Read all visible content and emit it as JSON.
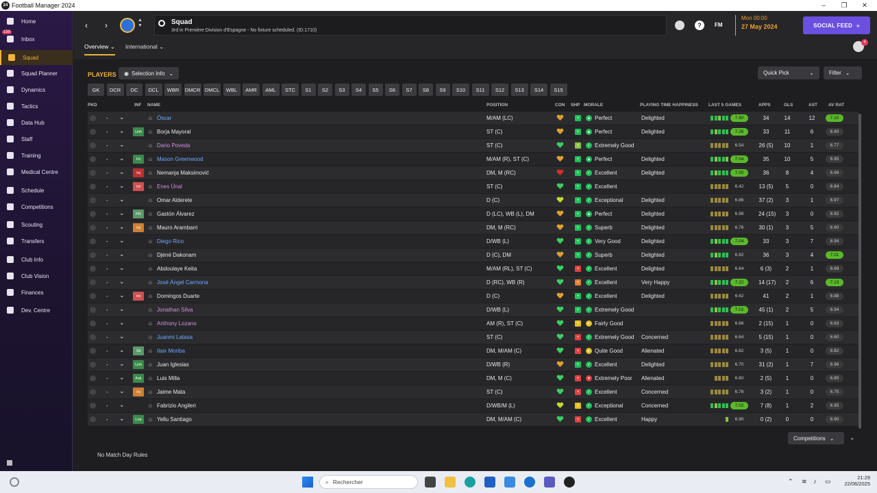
{
  "window": {
    "title": "Football Manager 2024",
    "icon_text": "24"
  },
  "sidebar": {
    "items": [
      {
        "label": "Home",
        "icon": "home-icon"
      },
      {
        "label": "Inbox",
        "icon": "inbox-icon",
        "badge": "150"
      },
      {
        "label": "Squad",
        "icon": "squad-icon",
        "active": true
      },
      {
        "label": "Squad Planner",
        "icon": "planner-icon"
      },
      {
        "label": "Dynamics",
        "icon": "dynamics-icon"
      },
      {
        "label": "Tactics",
        "icon": "tactics-icon"
      },
      {
        "label": "Data Hub",
        "icon": "datahub-icon"
      },
      {
        "label": "Staff",
        "icon": "staff-icon"
      },
      {
        "label": "Training",
        "icon": "training-icon"
      },
      {
        "label": "Medical Centre",
        "icon": "medical-icon"
      },
      {
        "label": "Schedule",
        "icon": "schedule-icon"
      },
      {
        "label": "Competitions",
        "icon": "trophy-icon"
      },
      {
        "label": "Scouting",
        "icon": "scouting-icon"
      },
      {
        "label": "Transfers",
        "icon": "transfers-icon"
      },
      {
        "label": "Club Info",
        "icon": "clubinfo-icon"
      },
      {
        "label": "Club Vision",
        "icon": "vision-icon"
      },
      {
        "label": "Finances",
        "icon": "finances-icon"
      },
      {
        "label": "Dev. Centre",
        "icon": "devcentre-icon"
      }
    ]
  },
  "header": {
    "title": "Squad",
    "subtitle": "3rd in Première Division d'Espagne - No fixture scheduled. (ID:1710)",
    "fm_label": "FM",
    "date_line1": "Mon 00:00",
    "date_line2": "27 May 2024",
    "social_feed": "SOCIAL FEED",
    "notif_count": "4",
    "tabs": [
      "Overview",
      "International"
    ]
  },
  "toolbar": {
    "players_label": "PLAYERS",
    "selection_info": "Selection Info",
    "quick_pick": "Quick Pick",
    "filter": "Filter",
    "positions": [
      "GK",
      "DCR",
      "DC",
      "DCL",
      "WBR",
      "DMCR",
      "DMCL",
      "WBL",
      "AMR",
      "AML",
      "STC",
      "S1",
      "S2",
      "S3",
      "S4",
      "S5",
      "S6",
      "S7",
      "S8",
      "S9",
      "S10",
      "S11",
      "S12",
      "S13",
      "S14",
      "S15"
    ]
  },
  "table": {
    "headers": {
      "pkd": "PKD",
      "inf": "INF",
      "name": "NAME",
      "position": "POSITION",
      "con": "CON",
      "shp": "SHP",
      "morale": "MORALE",
      "pth": "PLAYING TIME HAPPINESS",
      "last5": "LAST 5 GAMES",
      "apps": "APPS",
      "gls": "GLS",
      "ast": "AST",
      "avrat": "AV RAT"
    },
    "rows": [
      {
        "name": "Óscar",
        "nc": "blue",
        "inf": "",
        "pos": "M/AM (LC)",
        "morale": "Perfect",
        "mc": "#1fbf5a",
        "ms": "▲",
        "shp": "#1fbf5a",
        "pth": "Delighted",
        "rat": "7.90",
        "rc": "#5ab82a",
        "form": [
          1,
          1,
          0.6,
          1,
          0.8
        ],
        "apps": "34",
        "gls": "14",
        "ast": "12",
        "av": "7.10",
        "ac": "#5ab82a",
        "con": "#e0a030"
      },
      {
        "name": "Borja Mayoral",
        "nc": "",
        "inf": "Unh",
        "ic": "#3a8a4a",
        "pos": "ST (C)",
        "morale": "Perfect",
        "mc": "#1fbf5a",
        "ms": "▲",
        "shp": "#1fbf5a",
        "pth": "Delighted",
        "rat": "7.26",
        "rc": "#5ab82a",
        "form": [
          1,
          0.6,
          1,
          0.8,
          1
        ],
        "apps": "33",
        "gls": "11",
        "ast": "6",
        "av": "6.80",
        "ac": "",
        "con": "#e0a030"
      },
      {
        "name": "Dario Poveda",
        "nc": "pink",
        "inf": "",
        "pos": "ST (C)",
        "morale": "Extremely Good",
        "mc": "#1fbf5a",
        "ms": "✓",
        "shp": "#8bc34a",
        "pth": "",
        "rat": "6.54",
        "rc": "",
        "form": [
          0.5,
          0.5,
          0.5,
          0.5,
          0.5
        ],
        "apps": "26 (5)",
        "gls": "10",
        "ast": "1",
        "av": "6.77",
        "ac": "",
        "con": "#3ad060"
      },
      {
        "name": "Mason Greenwood",
        "nc": "blue",
        "inf": "Fit",
        "ic": "#3a8a4a",
        "pos": "M/AM (R), ST (C)",
        "morale": "Perfect",
        "mc": "#1fbf5a",
        "ms": "▲",
        "shp": "#1fbf5a",
        "pth": "Delighted",
        "rat": "7.04",
        "rc": "#5ab82a",
        "form": [
          1,
          0.6,
          0.8,
          1,
          0.7
        ],
        "apps": "35",
        "gls": "10",
        "ast": "5",
        "av": "6.95",
        "ac": "",
        "con": "#e0a030"
      },
      {
        "name": "Nemanja Maksimović",
        "nc": "",
        "inf": "Inj",
        "ic": "#c03030",
        "pos": "DM, M (RC)",
        "morale": "Excellent",
        "mc": "#1fbf5a",
        "ms": "✓",
        "shp": "#1fbf5a",
        "pth": "Delighted",
        "rat": "7.00",
        "rc": "#5ab82a",
        "form": [
          1,
          0.6,
          1,
          0.8,
          1
        ],
        "apps": "36",
        "gls": "8",
        "ast": "4",
        "av": "6.99",
        "ac": "",
        "con": "#d03030"
      },
      {
        "name": "Enes Ünal",
        "nc": "pink",
        "inf": "Int",
        "ic": "#d05050",
        "pos": "ST (C)",
        "morale": "Excellent",
        "mc": "#1fbf5a",
        "ms": "✓",
        "shp": "#1fbf5a",
        "pth": "",
        "rat": "6.42",
        "rc": "",
        "form": [
          0.5,
          0.5,
          0.5,
          0.5,
          0.5
        ],
        "apps": "13 (5)",
        "gls": "5",
        "ast": "0",
        "av": "6.84",
        "ac": "",
        "con": "#3ad060"
      },
      {
        "name": "Omar Alderete",
        "nc": "",
        "inf": "",
        "pos": "D (C)",
        "morale": "Exceptional",
        "mc": "#1fbf5a",
        "ms": "✓",
        "shp": "#1fbf5a",
        "pth": "Delighted",
        "rat": "6.86",
        "rc": "",
        "form": [
          0.5,
          0.5,
          0.5,
          0.5,
          0.5
        ],
        "apps": "37 (2)",
        "gls": "3",
        "ast": "1",
        "av": "6.97",
        "ac": "",
        "con": "#c8d830"
      },
      {
        "name": "Gastón Álvarez",
        "nc": "",
        "inf": "PR",
        "ic": "#5a9a6a",
        "pos": "D (LC), WB (L), DM",
        "morale": "Perfect",
        "mc": "#1fbf5a",
        "ms": "▲",
        "shp": "#1fbf5a",
        "pth": "Delighted",
        "rat": "6.98",
        "rc": "",
        "form": [
          0.5,
          0.5,
          0.5,
          0.5,
          0.5
        ],
        "apps": "24 (15)",
        "gls": "3",
        "ast": "0",
        "av": "6.92",
        "ac": "",
        "con": "#e0a030"
      },
      {
        "name": "Mauro Arambarri",
        "nc": "",
        "inf": "Inj",
        "ic": "#d08030",
        "pos": "DM, M (RC)",
        "morale": "Superb",
        "mc": "#1fbf5a",
        "ms": "✓",
        "shp": "#1fbf5a",
        "pth": "Delighted",
        "rat": "6.76",
        "rc": "",
        "form": [
          0.5,
          0.5,
          0.5,
          0.5,
          0.5
        ],
        "apps": "30 (1)",
        "gls": "3",
        "ast": "5",
        "av": "6.80",
        "ac": "",
        "con": "#e0a030"
      },
      {
        "name": "Diego Rico",
        "nc": "blue",
        "inf": "",
        "pos": "D/WB (L)",
        "morale": "Very Good",
        "mc": "#1fbf5a",
        "ms": "✓",
        "shp": "#1fbf5a",
        "pth": "Delighted",
        "rat": "7.04",
        "rc": "#5ab82a",
        "form": [
          1,
          0.6,
          1,
          0.8,
          1
        ],
        "apps": "33",
        "gls": "3",
        "ast": "7",
        "av": "6.94",
        "ac": "",
        "con": "#3ad060"
      },
      {
        "name": "Djéné Dakonam",
        "nc": "",
        "inf": "",
        "pos": "D (C), DM",
        "morale": "Superb",
        "mc": "#1fbf5a",
        "ms": "✓",
        "shp": "#1fbf5a",
        "pth": "Delighted",
        "rat": "6.92",
        "rc": "",
        "form": [
          1,
          0.6,
          1,
          0.8,
          1
        ],
        "apps": "36",
        "gls": "3",
        "ast": "4",
        "av": "7.01",
        "ac": "#5ab82a",
        "con": "#e0a030"
      },
      {
        "name": "Abdoulaye Keita",
        "nc": "",
        "inf": "",
        "pos": "M/AM (RL), ST (C)",
        "morale": "Excellent",
        "mc": "#1fbf5a",
        "ms": "✓",
        "shp": "#e04040",
        "pth": "Delighted",
        "rat": "6.64",
        "rc": "",
        "form": [
          0.5,
          0.5,
          0.5,
          0.5,
          0.5
        ],
        "apps": "6 (3)",
        "gls": "2",
        "ast": "1",
        "av": "6.69",
        "ac": "",
        "con": "#3ad060"
      },
      {
        "name": "José Ángel Carmona",
        "nc": "blue",
        "inf": "",
        "pos": "D (RC), WB (R)",
        "morale": "Excellent",
        "mc": "#1fbf5a",
        "ms": "✓",
        "shp": "#e08030",
        "pth": "Very Happy",
        "rat": "7.22",
        "rc": "#5ab82a",
        "form": [
          1,
          0.6,
          1,
          0.8,
          1
        ],
        "apps": "14 (17)",
        "gls": "2",
        "ast": "6",
        "av": "7.13",
        "ac": "#5ab82a",
        "con": "#3ad060"
      },
      {
        "name": "Domingos Duarte",
        "nc": "",
        "inf": "Int",
        "ic": "#d05050",
        "pos": "D (C)",
        "morale": "Excellent",
        "mc": "#1fbf5a",
        "ms": "✓",
        "shp": "#1fbf5a",
        "pth": "Delighted",
        "rat": "6.62",
        "rc": "",
        "form": [
          0.5,
          0.5,
          0.5,
          0.5,
          0.5
        ],
        "apps": "41",
        "gls": "2",
        "ast": "1",
        "av": "6.88",
        "ac": "",
        "con": "#e0a030"
      },
      {
        "name": "Jonathan Silva",
        "nc": "pink",
        "inf": "",
        "pos": "D/WB (L)",
        "morale": "Extremely Good",
        "mc": "#1fbf5a",
        "ms": "✓",
        "shp": "#1fbf5a",
        "pth": "",
        "rat": "7.02",
        "rc": "#5ab82a",
        "form": [
          1,
          0.6,
          1,
          0.8,
          1
        ],
        "apps": "45 (1)",
        "gls": "2",
        "ast": "5",
        "av": "6.94",
        "ac": "",
        "con": "#3ad060"
      },
      {
        "name": "Anthony Lozano",
        "nc": "pink",
        "inf": "",
        "pos": "AM (R), ST (C)",
        "morale": "Fairly Good",
        "mc": "#e0c020",
        "ms": "▸",
        "shp": "#e0c020",
        "pth": "",
        "rat": "6.66",
        "rc": "",
        "form": [
          0.5,
          0.5,
          0.5,
          0.5,
          0.5
        ],
        "apps": "2 (15)",
        "gls": "1",
        "ast": "0",
        "av": "6.63",
        "ac": "",
        "con": "#3ad060"
      },
      {
        "name": "Juanmi Latasa",
        "nc": "blue",
        "inf": "",
        "pos": "ST (C)",
        "morale": "Extremely Good",
        "mc": "#1fbf5a",
        "ms": "✓",
        "shp": "#e04040",
        "pth": "Concerned",
        "rat": "6.64",
        "rc": "",
        "form": [
          0.5,
          0.5,
          0.5,
          0.5,
          0.5
        ],
        "apps": "5 (15)",
        "gls": "1",
        "ast": "0",
        "av": "6.60",
        "ac": "",
        "con": "#3ad060"
      },
      {
        "name": "Ilaix Moriba",
        "nc": "blue",
        "inf": "Slt",
        "ic": "#5a9a6a",
        "pos": "DM, M/AM (C)",
        "morale": "Quite Good",
        "mc": "#e0c020",
        "ms": "▸",
        "shp": "#e04040",
        "pth": "Alienated",
        "rat": "6.82",
        "rc": "",
        "form": [
          0.5,
          0.5,
          0.5,
          0.5,
          0.5
        ],
        "apps": "3 (5)",
        "gls": "1",
        "ast": "0",
        "av": "6.82",
        "ac": "",
        "con": "#3ad060"
      },
      {
        "name": "Juan Iglesias",
        "nc": "",
        "inf": "Unh",
        "ic": "#3a8a4a",
        "pos": "D/WB (R)",
        "morale": "Excellent",
        "mc": "#1fbf5a",
        "ms": "✓",
        "shp": "#1fbf5a",
        "pth": "Delighted",
        "rat": "6.70",
        "rc": "",
        "form": [
          0.5,
          0.5,
          0.5,
          0.5,
          0.5
        ],
        "apps": "31 (2)",
        "gls": "1",
        "ast": "7",
        "av": "6.96",
        "ac": "",
        "con": "#e0a030"
      },
      {
        "name": "Luis Milla",
        "nc": "",
        "inf": "Ask",
        "ic": "#3a8a4a",
        "pos": "DM, M (C)",
        "morale": "Extremely Poor",
        "mc": "#e04040",
        "ms": "▾",
        "shp": "#e04040",
        "pth": "Alienated",
        "rat": "6.80",
        "rc": "",
        "form": [
          0,
          0.5,
          0.5,
          0.5,
          0.5
        ],
        "apps": "2 (5)",
        "gls": "1",
        "ast": "0",
        "av": "6.80",
        "ac": "",
        "con": "#3ad060"
      },
      {
        "name": "Jaime Mata",
        "nc": "",
        "inf": "Inj",
        "ic": "#d08030",
        "pos": "ST (C)",
        "morale": "Excellent",
        "mc": "#1fbf5a",
        "ms": "✓",
        "shp": "#e04040",
        "pth": "Concerned",
        "rat": "6.78",
        "rc": "",
        "form": [
          0.5,
          0.5,
          0.5,
          0.5,
          0.5
        ],
        "apps": "3 (2)",
        "gls": "1",
        "ast": "0",
        "av": "6.75",
        "ac": "",
        "con": "#3ad060"
      },
      {
        "name": "Fabrizio Angileri",
        "nc": "",
        "inf": "",
        "pos": "D/WB/M (L)",
        "morale": "Exceptional",
        "mc": "#1fbf5a",
        "ms": "✓",
        "shp": "#e0c020",
        "pth": "Concerned",
        "rat": "7.02",
        "rc": "#5ab82a",
        "form": [
          1,
          0.6,
          1,
          0.8,
          1
        ],
        "apps": "7 (8)",
        "gls": "1",
        "ast": "2",
        "av": "6.95",
        "ac": "",
        "con": "#c8d830"
      },
      {
        "name": "Yellu Santiago",
        "nc": "",
        "inf": "Loa",
        "ic": "#3a8a4a",
        "pos": "DM, M/AM (C)",
        "morale": "Excellent",
        "mc": "#1fbf5a",
        "ms": "✓",
        "shp": "#e04040",
        "pth": "Happy",
        "rat": "6.90",
        "rc": "",
        "form": [
          0,
          0,
          0,
          0,
          0.7
        ],
        "apps": "0 (2)",
        "gls": "0",
        "ast": "0",
        "av": "6.90",
        "ac": "",
        "con": "#3ad060"
      }
    ]
  },
  "footer": {
    "rules": "No Match Day Rules",
    "competitions": "Competitions"
  },
  "taskbar": {
    "search": "Rechercher",
    "time": "21:29",
    "date": "22/06/2025"
  }
}
